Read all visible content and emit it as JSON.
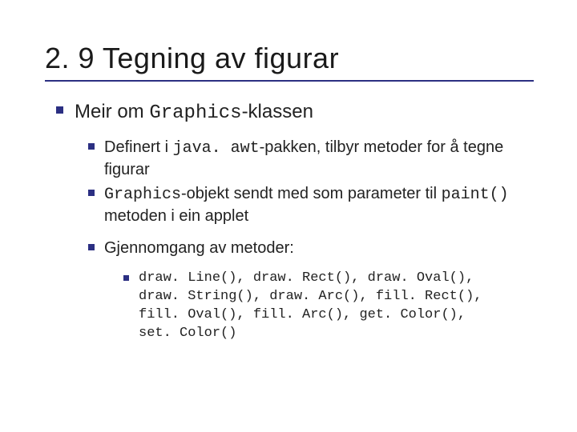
{
  "title": "2. 9 Tegning av figurar",
  "lvl1": {
    "pre": "Meir om ",
    "code": "Graphics",
    "post": "-klassen"
  },
  "lvl2_a": {
    "pre": "Definert i ",
    "code": "java. awt",
    "post": "-pakken, tilbyr metoder for å tegne figurar"
  },
  "lvl2_b": {
    "code1": "Graphics",
    "mid": "-objekt sendt med som parameter til ",
    "code2": "paint()",
    "post": " metoden i ein applet"
  },
  "lvl2_c": {
    "text": "Gjennomgang av metoder:"
  },
  "lvl3": {
    "code": "draw. Line(), draw. Rect(), draw. Oval(), draw. String(), draw. Arc(), fill. Rect(), fill. Oval(), fill. Arc(), get. Color(), set. Color()"
  }
}
